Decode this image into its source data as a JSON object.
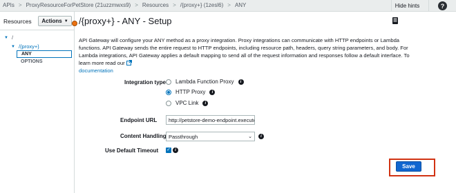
{
  "breadcrumb": [
    "APIs",
    "ProxyResourceForPetStore (21uzzmwxs9)",
    "Resources",
    "/{proxy+} (1zesl6)",
    "ANY"
  ],
  "header": {
    "hide_hints": "Hide hints",
    "help": "?"
  },
  "left_panel": {
    "title": "Resources",
    "actions_label": "Actions",
    "tree": {
      "root": "/",
      "proxy": "/{proxy+}",
      "selected": "ANY",
      "options": "OPTIONS"
    }
  },
  "main": {
    "title": "/{proxy+} - ANY - Setup",
    "description": "API Gateway will configure your ANY method as a proxy integration. Proxy integrations can communicate with HTTP endpoints or Lambda functions. API Gateway sends the entire request to HTTP endpoints, including resource path, headers, query string parameters, and body. For Lambda integrations, API Gateway applies a default mapping to send all of the request information and responses follow a default interface. To learn more read our",
    "doc_link": "documentation",
    "integration_type_label": "Integration type",
    "integration_options": [
      "Lambda Function Proxy",
      "HTTP Proxy",
      "VPC Link"
    ],
    "integration_selected": "HTTP Proxy",
    "endpoint_url_label": "Endpoint URL",
    "endpoint_url_value": "http://petstore-demo-endpoint.execute-api.com/petstore/pets",
    "content_handling_label": "Content Handling",
    "content_handling_value": "Passthrough",
    "use_default_timeout_label": "Use Default Timeout",
    "use_default_timeout_checked": true,
    "save_label": "Save"
  },
  "colors": {
    "accent": "#0073bb",
    "save_button": "#1066d0",
    "highlight_frame": "#d13212"
  }
}
